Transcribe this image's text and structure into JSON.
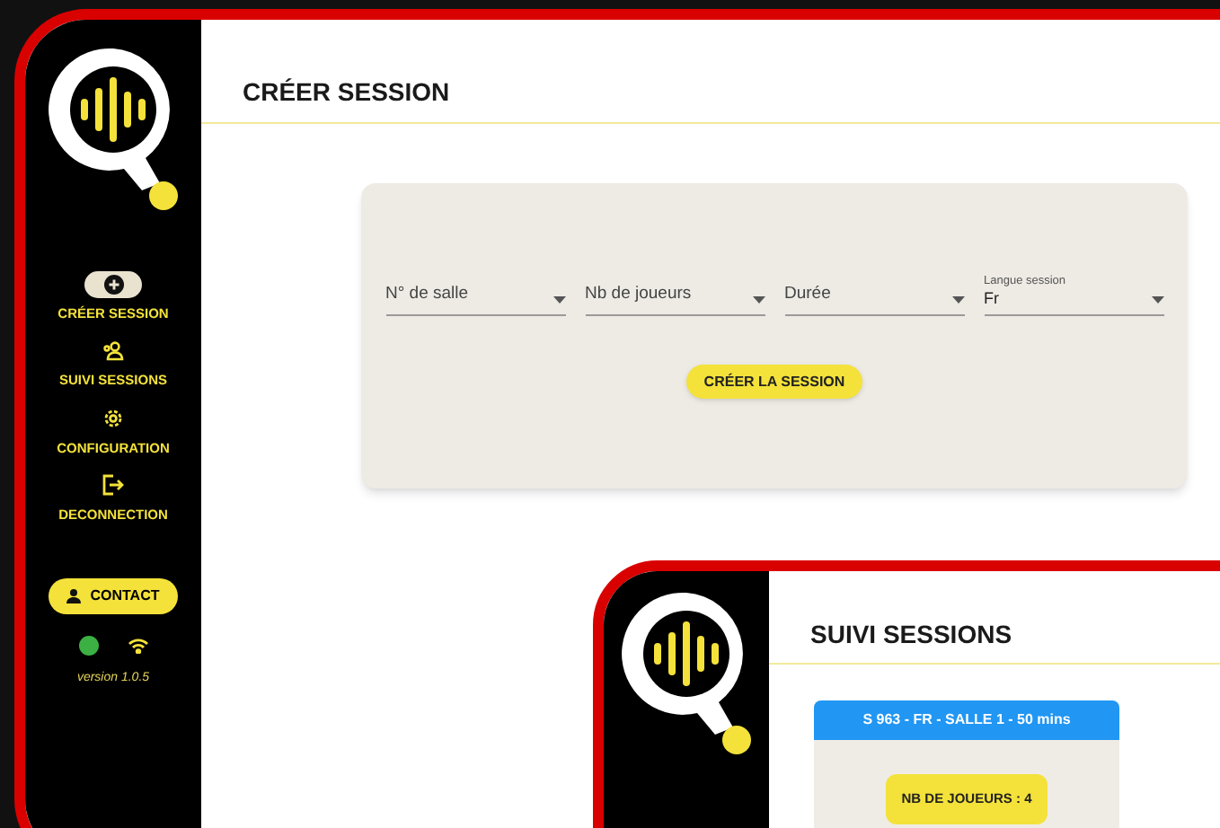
{
  "screens": [
    {
      "sidebar": {
        "nav": [
          {
            "label": "CRÉER SESSION",
            "kind": "plus",
            "selected": true
          },
          {
            "label": "SUIVI SESSIONS",
            "kind": "people",
            "selected": false
          },
          {
            "label": "CONFIGURATION",
            "kind": "gear",
            "selected": false
          },
          {
            "label": "DECONNECTION",
            "kind": "logout",
            "selected": false
          }
        ],
        "contact": "CONTACT",
        "online": true,
        "version": "version 1.0.5"
      },
      "page_title": "CRÉER SESSION",
      "form": {
        "fields": [
          {
            "label": "N° de salle"
          },
          {
            "label": "Nb de joueurs"
          },
          {
            "label": "Durée"
          },
          {
            "label": "Langue session",
            "value": "Fr"
          }
        ],
        "submit": "CRÉER LA SESSION"
      }
    },
    {
      "page_title": "SUIVI SESSIONS",
      "session_card": {
        "header": "S 963 - FR - SALLE 1 - 50 mins",
        "players": "NB DE JOUEURS : 4"
      }
    }
  ]
}
